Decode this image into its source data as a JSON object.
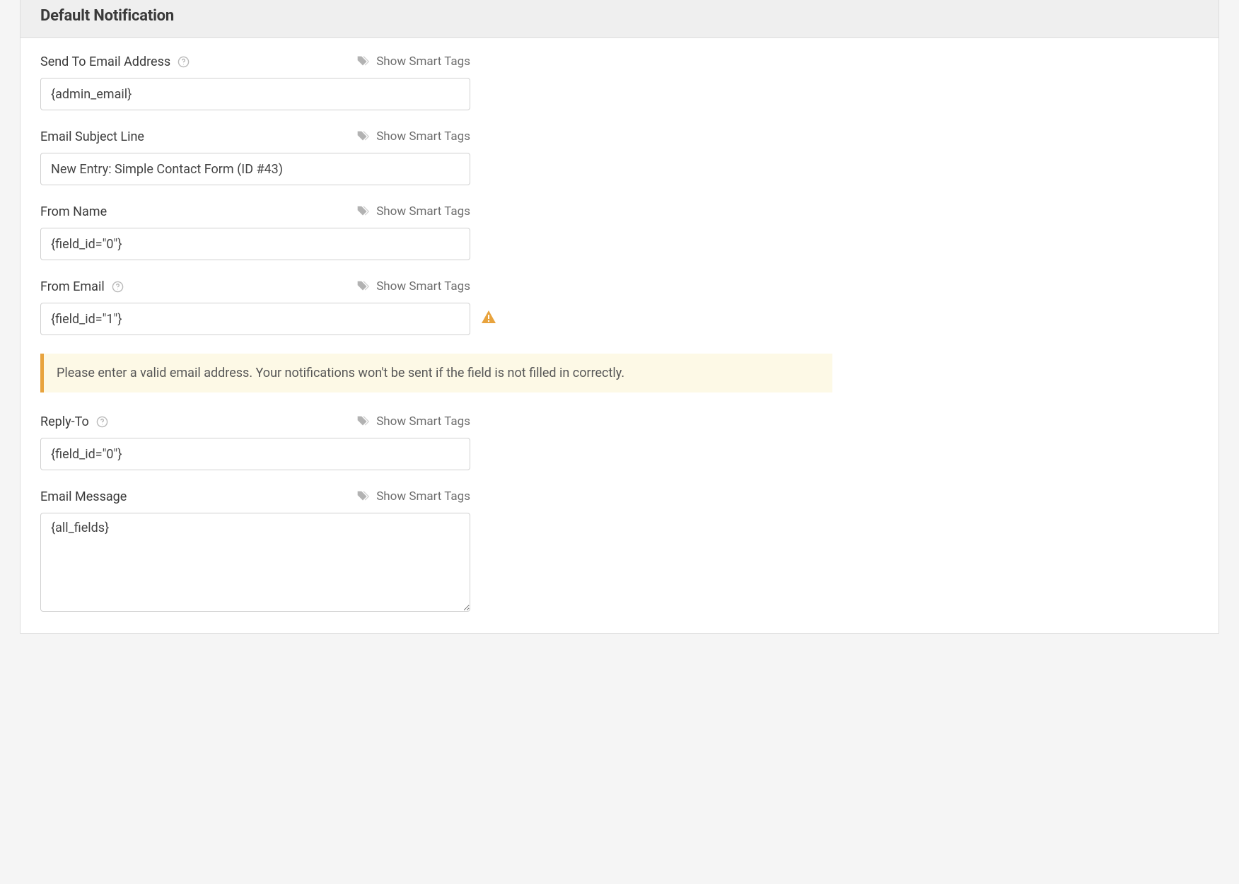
{
  "header": {
    "title": "Default Notification"
  },
  "labels": {
    "send_to": "Send To Email Address",
    "subject": "Email Subject Line",
    "from_name": "From Name",
    "from_email": "From Email",
    "reply_to": "Reply-To",
    "email_message": "Email Message",
    "smart_tags": "Show Smart Tags"
  },
  "values": {
    "send_to": "{admin_email}",
    "subject": "New Entry: Simple Contact Form (ID #43)",
    "from_name": "{field_id=\"0\"}",
    "from_email": "{field_id=\"1\"}",
    "reply_to": "{field_id=\"0\"}",
    "email_message": "{all_fields}"
  },
  "alerts": {
    "from_email_warning": "Please enter a valid email address. Your notifications won't be sent if the field is not filled in correctly."
  }
}
